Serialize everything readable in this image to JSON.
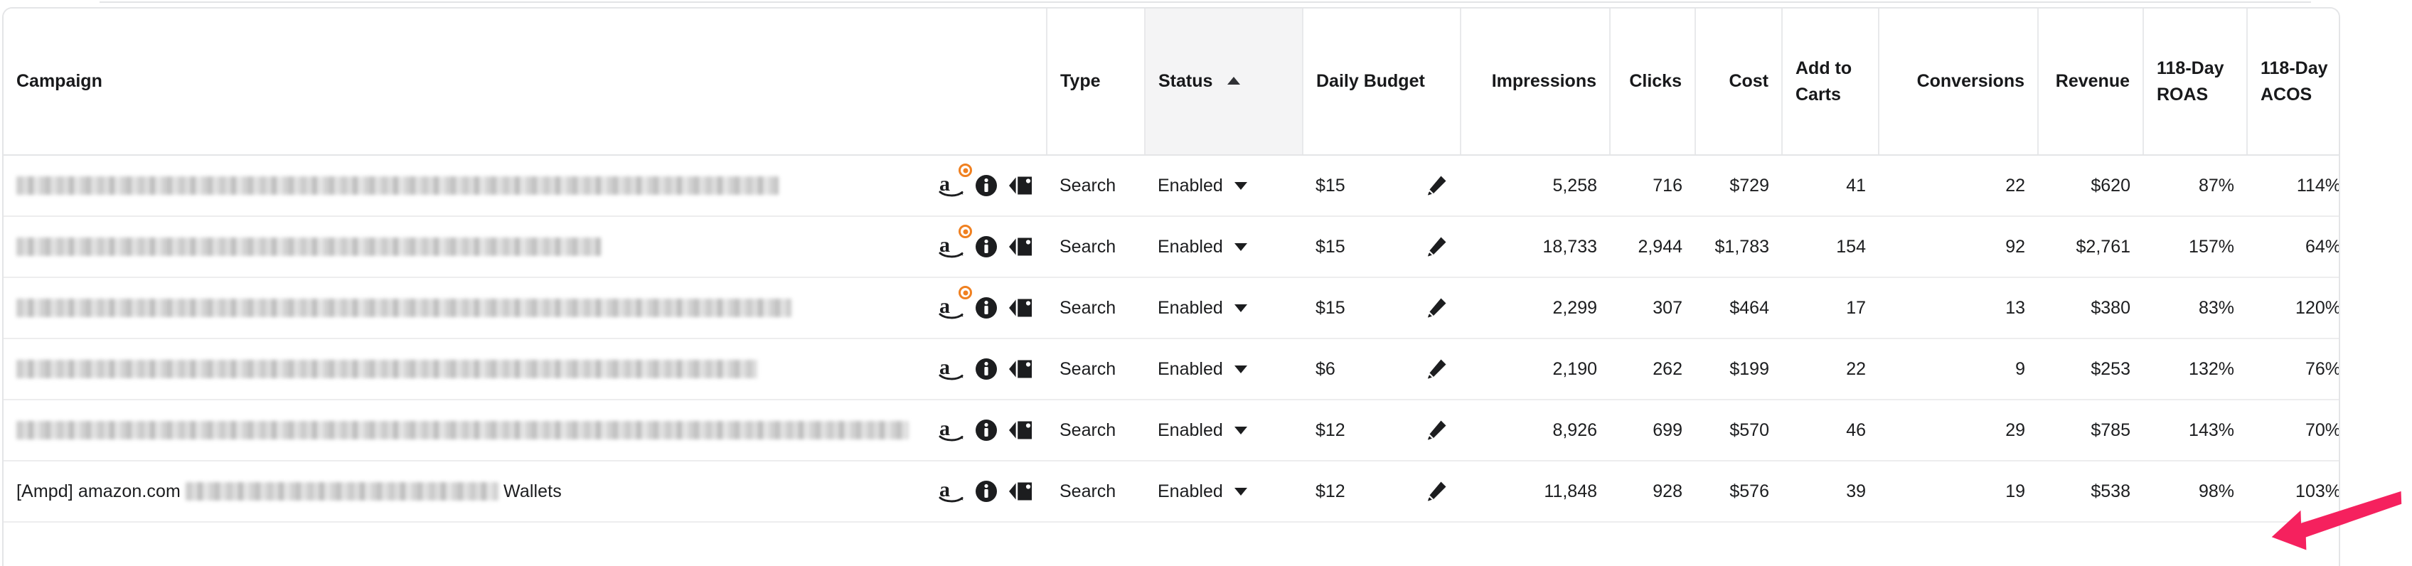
{
  "table": {
    "columns": [
      {
        "key": "campaign",
        "label": "Campaign",
        "align": "left"
      },
      {
        "key": "type",
        "label": "Type",
        "align": "left"
      },
      {
        "key": "status",
        "label": "Status",
        "align": "left",
        "sorted": "asc"
      },
      {
        "key": "daily",
        "label": "Daily Budget",
        "align": "left"
      },
      {
        "key": "impressions",
        "label": "Impressions",
        "align": "right"
      },
      {
        "key": "clicks",
        "label": "Clicks",
        "align": "right"
      },
      {
        "key": "cost",
        "label": "Cost",
        "align": "right"
      },
      {
        "key": "atc",
        "label": "Add to Carts",
        "align": "right"
      },
      {
        "key": "conversions",
        "label": "Conversions",
        "align": "right"
      },
      {
        "key": "revenue",
        "label": "Revenue",
        "align": "right"
      },
      {
        "key": "roas",
        "label": "118-Day ROAS",
        "align": "right"
      },
      {
        "key": "acos",
        "label": "118-Day ACOS",
        "align": "right"
      }
    ],
    "sort_indicator": "ascending-caret",
    "status_dropdown_caret": "chevron-down-icon",
    "budget_edit_icon": "pencil-icon",
    "row_icons": [
      "amazon-logo-icon",
      "info-circle-icon",
      "tag-icon"
    ],
    "rows": [
      {
        "campaign_prefix": "",
        "campaign_redacted": true,
        "campaign_redacted_width": 1072,
        "campaign_suffix": "",
        "amazon_badge": true,
        "type": "Search",
        "status": "Enabled",
        "daily_budget": "$15",
        "impressions": "5,258",
        "clicks": "716",
        "cost": "$729",
        "add_to_carts": "41",
        "conversions": "22",
        "revenue": "$620",
        "roas": "87%",
        "acos": "114%"
      },
      {
        "campaign_prefix": "",
        "campaign_redacted": true,
        "campaign_redacted_width": 822,
        "campaign_suffix": "",
        "amazon_badge": true,
        "type": "Search",
        "status": "Enabled",
        "daily_budget": "$15",
        "impressions": "18,733",
        "clicks": "2,944",
        "cost": "$1,783",
        "add_to_carts": "154",
        "conversions": "92",
        "revenue": "$2,761",
        "roas": "157%",
        "acos": "64%"
      },
      {
        "campaign_prefix": "",
        "campaign_redacted": true,
        "campaign_redacted_width": 1090,
        "campaign_suffix": "",
        "amazon_badge": true,
        "type": "Search",
        "status": "Enabled",
        "daily_budget": "$15",
        "impressions": "2,299",
        "clicks": "307",
        "cost": "$464",
        "add_to_carts": "17",
        "conversions": "13",
        "revenue": "$380",
        "roas": "83%",
        "acos": "120%"
      },
      {
        "campaign_prefix": "",
        "campaign_redacted": true,
        "campaign_redacted_width": 1042,
        "campaign_suffix": "",
        "amazon_badge": false,
        "type": "Search",
        "status": "Enabled",
        "daily_budget": "$6",
        "impressions": "2,190",
        "clicks": "262",
        "cost": "$199",
        "add_to_carts": "22",
        "conversions": "9",
        "revenue": "$253",
        "roas": "132%",
        "acos": "76%"
      },
      {
        "campaign_prefix": "",
        "campaign_redacted": true,
        "campaign_redacted_width": 1255,
        "campaign_suffix": "",
        "amazon_badge": false,
        "type": "Search",
        "status": "Enabled",
        "daily_budget": "$12",
        "impressions": "8,926",
        "clicks": "699",
        "cost": "$570",
        "add_to_carts": "46",
        "conversions": "29",
        "revenue": "$785",
        "roas": "143%",
        "acos": "70%"
      },
      {
        "campaign_prefix": "[Ampd] amazon.com ",
        "campaign_redacted": true,
        "campaign_redacted_width": 440,
        "campaign_suffix": " Wallets",
        "amazon_badge": false,
        "type": "Search",
        "status": "Enabled",
        "daily_budget": "$12",
        "impressions": "11,848",
        "clicks": "928",
        "cost": "$576",
        "add_to_carts": "39",
        "conversions": "19",
        "revenue": "$538",
        "roas": "98%",
        "acos": "103%"
      }
    ]
  },
  "annotation": {
    "name": "pink-pointer-arrow",
    "color": "#f5215e",
    "points_to": "103%"
  },
  "colors": {
    "border": "#e4e5e7",
    "row_divider": "#ededee",
    "sorted_header_bg": "#f4f4f5",
    "amazon_orange": "#f08020",
    "text": "#1c1d1f",
    "annotation_pink": "#f5215e"
  }
}
